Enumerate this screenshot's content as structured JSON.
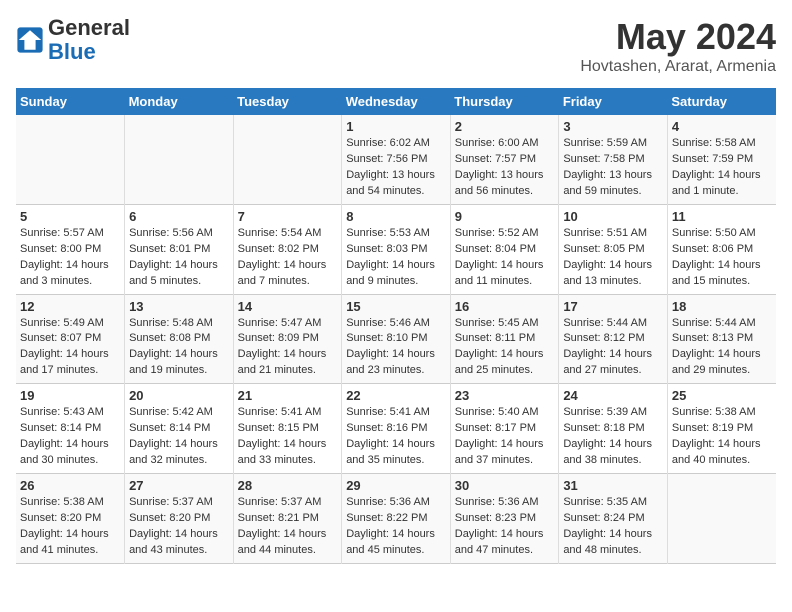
{
  "logo": {
    "general": "General",
    "blue": "Blue"
  },
  "title": "May 2024",
  "subtitle": "Hovtashen, Ararat, Armenia",
  "headers": [
    "Sunday",
    "Monday",
    "Tuesday",
    "Wednesday",
    "Thursday",
    "Friday",
    "Saturday"
  ],
  "weeks": [
    [
      {
        "day": "",
        "info": ""
      },
      {
        "day": "",
        "info": ""
      },
      {
        "day": "",
        "info": ""
      },
      {
        "day": "1",
        "info": "Sunrise: 6:02 AM\nSunset: 7:56 PM\nDaylight: 13 hours\nand 54 minutes."
      },
      {
        "day": "2",
        "info": "Sunrise: 6:00 AM\nSunset: 7:57 PM\nDaylight: 13 hours\nand 56 minutes."
      },
      {
        "day": "3",
        "info": "Sunrise: 5:59 AM\nSunset: 7:58 PM\nDaylight: 13 hours\nand 59 minutes."
      },
      {
        "day": "4",
        "info": "Sunrise: 5:58 AM\nSunset: 7:59 PM\nDaylight: 14 hours\nand 1 minute."
      }
    ],
    [
      {
        "day": "5",
        "info": "Sunrise: 5:57 AM\nSunset: 8:00 PM\nDaylight: 14 hours\nand 3 minutes."
      },
      {
        "day": "6",
        "info": "Sunrise: 5:56 AM\nSunset: 8:01 PM\nDaylight: 14 hours\nand 5 minutes."
      },
      {
        "day": "7",
        "info": "Sunrise: 5:54 AM\nSunset: 8:02 PM\nDaylight: 14 hours\nand 7 minutes."
      },
      {
        "day": "8",
        "info": "Sunrise: 5:53 AM\nSunset: 8:03 PM\nDaylight: 14 hours\nand 9 minutes."
      },
      {
        "day": "9",
        "info": "Sunrise: 5:52 AM\nSunset: 8:04 PM\nDaylight: 14 hours\nand 11 minutes."
      },
      {
        "day": "10",
        "info": "Sunrise: 5:51 AM\nSunset: 8:05 PM\nDaylight: 14 hours\nand 13 minutes."
      },
      {
        "day": "11",
        "info": "Sunrise: 5:50 AM\nSunset: 8:06 PM\nDaylight: 14 hours\nand 15 minutes."
      }
    ],
    [
      {
        "day": "12",
        "info": "Sunrise: 5:49 AM\nSunset: 8:07 PM\nDaylight: 14 hours\nand 17 minutes."
      },
      {
        "day": "13",
        "info": "Sunrise: 5:48 AM\nSunset: 8:08 PM\nDaylight: 14 hours\nand 19 minutes."
      },
      {
        "day": "14",
        "info": "Sunrise: 5:47 AM\nSunset: 8:09 PM\nDaylight: 14 hours\nand 21 minutes."
      },
      {
        "day": "15",
        "info": "Sunrise: 5:46 AM\nSunset: 8:10 PM\nDaylight: 14 hours\nand 23 minutes."
      },
      {
        "day": "16",
        "info": "Sunrise: 5:45 AM\nSunset: 8:11 PM\nDaylight: 14 hours\nand 25 minutes."
      },
      {
        "day": "17",
        "info": "Sunrise: 5:44 AM\nSunset: 8:12 PM\nDaylight: 14 hours\nand 27 minutes."
      },
      {
        "day": "18",
        "info": "Sunrise: 5:44 AM\nSunset: 8:13 PM\nDaylight: 14 hours\nand 29 minutes."
      }
    ],
    [
      {
        "day": "19",
        "info": "Sunrise: 5:43 AM\nSunset: 8:14 PM\nDaylight: 14 hours\nand 30 minutes."
      },
      {
        "day": "20",
        "info": "Sunrise: 5:42 AM\nSunset: 8:14 PM\nDaylight: 14 hours\nand 32 minutes."
      },
      {
        "day": "21",
        "info": "Sunrise: 5:41 AM\nSunset: 8:15 PM\nDaylight: 14 hours\nand 33 minutes."
      },
      {
        "day": "22",
        "info": "Sunrise: 5:41 AM\nSunset: 8:16 PM\nDaylight: 14 hours\nand 35 minutes."
      },
      {
        "day": "23",
        "info": "Sunrise: 5:40 AM\nSunset: 8:17 PM\nDaylight: 14 hours\nand 37 minutes."
      },
      {
        "day": "24",
        "info": "Sunrise: 5:39 AM\nSunset: 8:18 PM\nDaylight: 14 hours\nand 38 minutes."
      },
      {
        "day": "25",
        "info": "Sunrise: 5:38 AM\nSunset: 8:19 PM\nDaylight: 14 hours\nand 40 minutes."
      }
    ],
    [
      {
        "day": "26",
        "info": "Sunrise: 5:38 AM\nSunset: 8:20 PM\nDaylight: 14 hours\nand 41 minutes."
      },
      {
        "day": "27",
        "info": "Sunrise: 5:37 AM\nSunset: 8:20 PM\nDaylight: 14 hours\nand 43 minutes."
      },
      {
        "day": "28",
        "info": "Sunrise: 5:37 AM\nSunset: 8:21 PM\nDaylight: 14 hours\nand 44 minutes."
      },
      {
        "day": "29",
        "info": "Sunrise: 5:36 AM\nSunset: 8:22 PM\nDaylight: 14 hours\nand 45 minutes."
      },
      {
        "day": "30",
        "info": "Sunrise: 5:36 AM\nSunset: 8:23 PM\nDaylight: 14 hours\nand 47 minutes."
      },
      {
        "day": "31",
        "info": "Sunrise: 5:35 AM\nSunset: 8:24 PM\nDaylight: 14 hours\nand 48 minutes."
      },
      {
        "day": "",
        "info": ""
      }
    ]
  ]
}
